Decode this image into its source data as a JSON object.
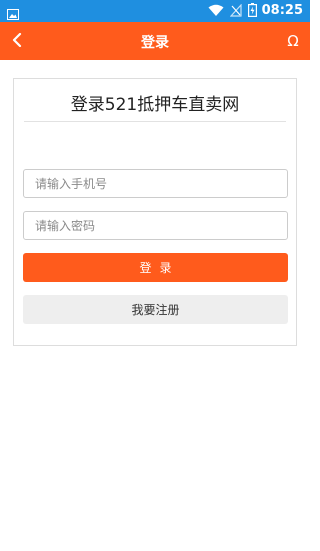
{
  "status_bar": {
    "time": "08:25",
    "icons": [
      "gallery-icon",
      "wifi-icon",
      "no-signal-icon",
      "battery-icon"
    ]
  },
  "app_bar": {
    "title": "登录",
    "back_icon": "chevron-left-icon",
    "right_icon": "omega-icon",
    "right_glyph": "Ω"
  },
  "login_card": {
    "title": "登录521抵押车直卖网",
    "phone_placeholder": "请输入手机号",
    "phone_value": "",
    "password_placeholder": "请输入密码",
    "password_value": "",
    "login_label": "登录",
    "register_label": "我要注册"
  },
  "colors": {
    "status_bar": "#1f8fe0",
    "accent": "#ff5b1c",
    "secondary_button": "#eeeeee"
  }
}
